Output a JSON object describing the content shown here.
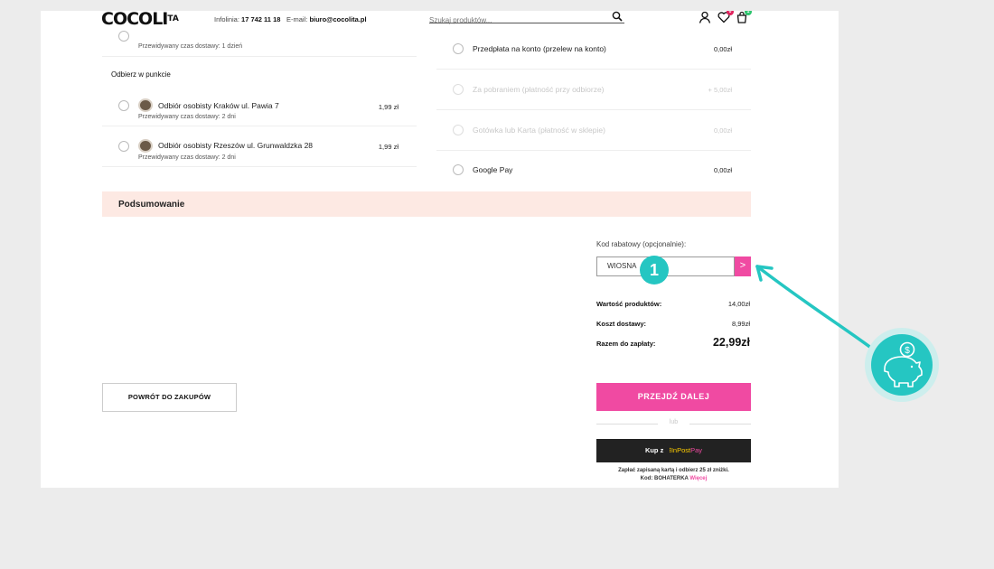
{
  "header": {
    "logo_text": "COCOLI",
    "logo_suffix": "TA",
    "phone_label": "Infolinia:",
    "phone": "17 742 11 18",
    "email_label": "E-mail:",
    "email": "biuro@cocolita.pl",
    "search_placeholder": "Szukaj produktów...",
    "wishlist_count": "0",
    "cart_count": "1"
  },
  "delivery": {
    "top_partial": {
      "label": "",
      "eta": "Przewidywany czas dostawy: 1 dzień",
      "price": ""
    },
    "pickup_heading": "Odbierz w punkcie",
    "options": [
      {
        "label": "Odbiór osobisty Kraków ul. Pawia 7",
        "eta": "Przewidywany czas dostawy: 2 dni",
        "price": "1,99 zł"
      },
      {
        "label": "Odbiór osobisty Rzeszów ul. Grunwaldzka 28",
        "eta": "Przewidywany czas dostawy: 2 dni",
        "price": "1,99 zł"
      }
    ]
  },
  "payment": {
    "options": [
      {
        "label": "Przedpłata na konto (przelew na konto)",
        "price": "0,00zł",
        "enabled": true
      },
      {
        "label": "Za pobraniem (płatność przy odbiorze)",
        "price": "+ 5,00zł",
        "enabled": false
      },
      {
        "label": "Gotówka lub Karta (płatność w sklepie)",
        "price": "0,00zł",
        "enabled": false
      },
      {
        "label": "Google Pay",
        "price": "0,00zł",
        "enabled": true
      }
    ]
  },
  "summary": {
    "heading": "Podsumowanie",
    "code_label": "Kod rabatowy (opcjonalnie):",
    "code_value": "WIOSNA",
    "code_button": ">",
    "products_label": "Wartość produktów:",
    "products_value": "14,00zł",
    "shipping_label": "Koszt dostawy:",
    "shipping_value": "8,99zł",
    "total_label": "Razem do zapłaty:",
    "total_value": "22,99zł"
  },
  "actions": {
    "back_label": "POWRÓT DO ZAKUPÓW",
    "next_label": "PRZEJDŹ DALEJ",
    "or_label": "lub",
    "inpost_prefix": "Kup z",
    "inpost_brand": "InPost",
    "inpost_pay": "Pay",
    "promo_line1": "Zapłać zapisaną kartą i odbierz 25 zł zniżki.",
    "promo_line2_prefix": "Kod: BOHATERKA",
    "promo_more": "Więcej"
  },
  "annotation": {
    "step_number": "1"
  },
  "colors": {
    "accent_pink": "#f04aa2",
    "teal": "#25c6c2",
    "summary_bg": "#fde9e3"
  }
}
